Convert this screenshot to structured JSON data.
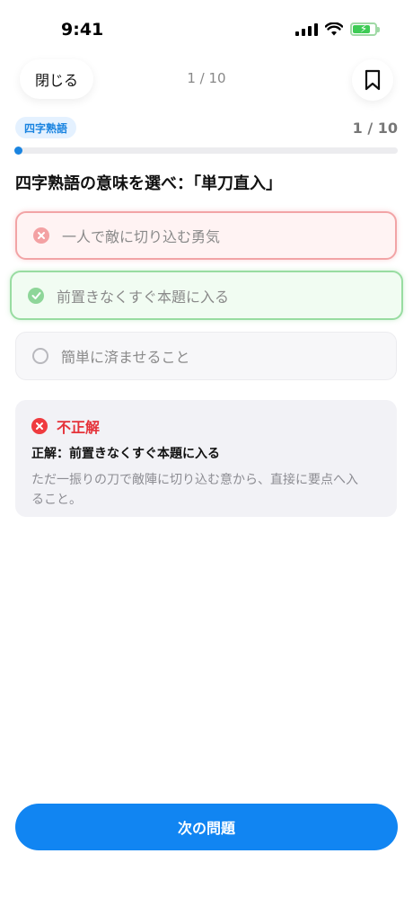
{
  "status_bar": {
    "time": "9:41"
  },
  "top_bar": {
    "close_label": "閉じる",
    "counter": "1 / 10"
  },
  "quiz": {
    "category": "四字熟語",
    "progress_text": "1 / 10",
    "progress_fraction": 0.1,
    "question": "四字熟語の意味を選べ：「単刀直入」",
    "options": [
      {
        "label": "一人で敵に切り込む勇気",
        "state": "wrong"
      },
      {
        "label": "前置きなくすぐ本題に入る",
        "state": "correct"
      },
      {
        "label": "簡単に済ませること",
        "state": "neutral"
      }
    ]
  },
  "feedback": {
    "status": "不正解",
    "answer": "正解：前置きなくすぐ本題に入る",
    "explanation": "ただ一振りの刀で敵陣に切り込む意から、直接に要点へ入ること。"
  },
  "footer": {
    "next_label": "次の問題"
  },
  "colors": {
    "accent": "#1185f2",
    "wrong": "#ef3b3f",
    "correct": "#8ed699"
  },
  "icons": [
    "wifi-icon",
    "battery-icon",
    "bookmark-icon",
    "x-circle-icon",
    "check-circle-icon",
    "empty-radio-icon"
  ]
}
